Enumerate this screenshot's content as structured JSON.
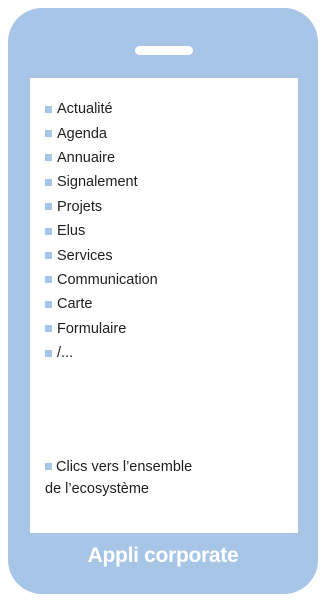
{
  "menu": {
    "items": [
      {
        "label": "Actualité"
      },
      {
        "label": "Agenda"
      },
      {
        "label": "Annuaire"
      },
      {
        "label": "Signalement"
      },
      {
        "label": "Projets"
      },
      {
        "label": "Elus"
      },
      {
        "label": "Services"
      },
      {
        "label": "Communication"
      },
      {
        "label": "Carte"
      },
      {
        "label": "Formulaire"
      },
      {
        "label": "/..."
      }
    ]
  },
  "note": {
    "line1": "Clics vers l’ensemble",
    "line2": "de l’ecosystème"
  },
  "footer": {
    "title": "Appli corporate"
  },
  "colors": {
    "phone_body": "#a7c6e7",
    "screen": "#ffffff",
    "text": "#1e1e1e",
    "footer_text": "#ffffff"
  }
}
